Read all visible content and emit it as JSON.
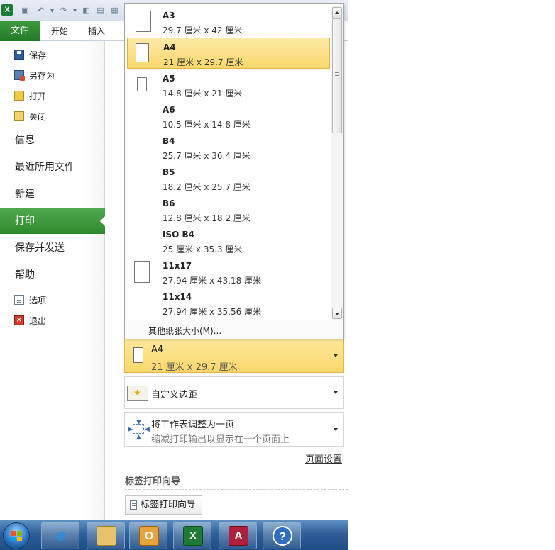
{
  "window": {
    "qat_icons": [
      "excel-logo",
      "save-icon",
      "undo-icon",
      "redo-icon",
      "print-preview-icon",
      "quick-print-icon",
      "table-icon"
    ]
  },
  "ribbon": {
    "file_tab": "文件",
    "tabs": [
      "开始",
      "插入"
    ]
  },
  "backstage": {
    "commands": [
      {
        "label": "保存",
        "icon": "save-icon"
      },
      {
        "label": "另存为",
        "icon": "save-as-icon"
      },
      {
        "label": "打开",
        "icon": "open-folder-icon"
      },
      {
        "label": "关闭",
        "icon": "close-folder-icon"
      }
    ],
    "sections": [
      "信息",
      "最近所用文件",
      "新建",
      "打印",
      "保存并发送",
      "帮助"
    ],
    "selected_section": "打印",
    "bottom_commands": [
      {
        "label": "选项",
        "icon": "options-icon"
      },
      {
        "label": "退出",
        "icon": "exit-icon"
      }
    ]
  },
  "paper_dropdown": {
    "items": [
      {
        "name": "A3",
        "dims": "29.7 厘米 x 42 厘米",
        "icon": "page-icon"
      },
      {
        "name": "A4",
        "dims": "21 厘米 x 29.7 厘米",
        "icon": "page-icon"
      },
      {
        "name": "A5",
        "dims": "14.8 厘米 x 21 厘米",
        "icon": "page-icon"
      },
      {
        "name": "A6",
        "dims": "10.5 厘米 x 14.8 厘米"
      },
      {
        "name": "B4",
        "dims": "25.7 厘米 x 36.4 厘米"
      },
      {
        "name": "B5",
        "dims": "18.2 厘米 x 25.7 厘米"
      },
      {
        "name": "B6",
        "dims": "12.8 厘米 x 18.2 厘米"
      },
      {
        "name": "ISO B4",
        "dims": "25 厘米 x 35.3 厘米"
      },
      {
        "name": "11x17",
        "dims": "27.94 厘米 x 43.18 厘米",
        "icon": "page-icon"
      },
      {
        "name": "11x14",
        "dims": "27.94 厘米 x 35.56 厘米"
      }
    ],
    "selected": "A4",
    "more_sizes": "其他纸张大小(M)..."
  },
  "print_settings": {
    "paper_size": {
      "name": "A4",
      "dims": "21 厘米 x 29.7 厘米"
    },
    "margins": {
      "label": "自定义边距"
    },
    "scaling": {
      "title": "将工作表调整为一页",
      "subtitle": "缩减打印输出以显示在一个页面上"
    },
    "page_setup_link": "页面设置"
  },
  "label_wizard": {
    "heading": "标签打印向导",
    "button": "标签打印向导"
  },
  "taskbar": {
    "apps": [
      "start-orb",
      "internet-explorer-icon",
      "file-explorer-icon",
      "outlook-icon",
      "excel-icon",
      "access-icon",
      "help-icon"
    ]
  },
  "colors": {
    "file_tab": "#2d8a2c",
    "selection": "#fad76b",
    "taskbar": "#2e5f98"
  }
}
